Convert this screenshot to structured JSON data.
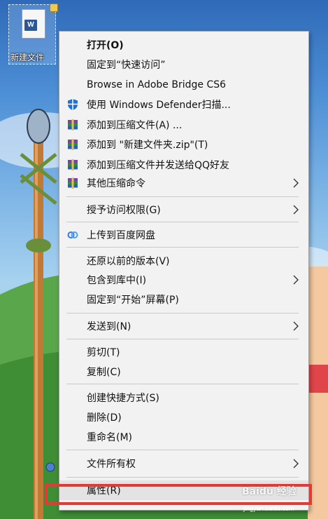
{
  "desktop": {
    "file_label": "新建文件",
    "file_glyph": "W"
  },
  "menu": {
    "items": [
      {
        "label": "打开(O)",
        "bold": true,
        "icon": "",
        "submenu": false
      },
      {
        "label": "固定到“快速访问”",
        "icon": "",
        "submenu": false
      },
      {
        "label": "Browse in Adobe Bridge CS6",
        "icon": "",
        "submenu": false
      },
      {
        "label": "使用 Windows Defender扫描...",
        "icon": "windows-defender-shield-icon",
        "submenu": false
      },
      {
        "label": "添加到压缩文件(A) ...",
        "icon": "winrar-icon",
        "submenu": false
      },
      {
        "label": "添加到 \"新建文件夹.zip\"(T)",
        "icon": "winrar-icon",
        "submenu": false
      },
      {
        "label": "添加到压缩文件并发送给QQ好友",
        "icon": "winrar-icon",
        "submenu": false
      },
      {
        "label": "其他压缩命令",
        "icon": "winrar-icon",
        "submenu": true
      },
      {
        "label": "授予访问权限(G)",
        "icon": "",
        "submenu": true
      },
      {
        "label": "上传到百度网盘",
        "icon": "baidu-netdisk-icon",
        "submenu": false
      },
      {
        "label": "还原以前的版本(V)",
        "icon": "",
        "submenu": false
      },
      {
        "label": "包含到库中(I)",
        "icon": "",
        "submenu": true
      },
      {
        "label": "固定到“开始”屏幕(P)",
        "icon": "",
        "submenu": false
      },
      {
        "label": "发送到(N)",
        "icon": "",
        "submenu": true
      },
      {
        "label": "剪切(T)",
        "icon": "",
        "submenu": false
      },
      {
        "label": "复制(C)",
        "icon": "",
        "submenu": false
      },
      {
        "label": "创建快捷方式(S)",
        "icon": "",
        "submenu": false
      },
      {
        "label": "删除(D)",
        "icon": "",
        "submenu": false
      },
      {
        "label": "重命名(M)",
        "icon": "",
        "submenu": false
      },
      {
        "label": "文件所有权",
        "icon": "",
        "submenu": true
      },
      {
        "label": "属性(R)",
        "icon": "",
        "submenu": false
      }
    ]
  },
  "watermark": {
    "text": "Baidu 经验",
    "url": "jingyan.baidu.com"
  },
  "colors": {
    "menu_bg": "#f2f2f2",
    "highlight_box": "#e53935",
    "hover_bg": "#e3e3e3"
  }
}
